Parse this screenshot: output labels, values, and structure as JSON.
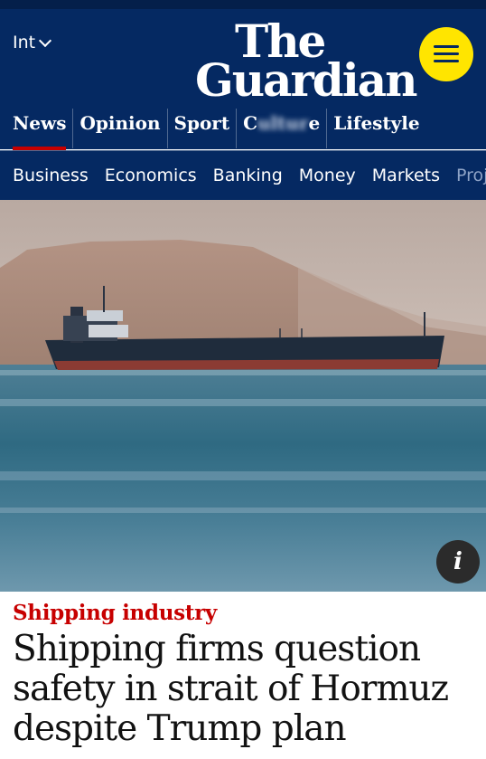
{
  "header": {
    "edition": "Int",
    "logo_line1": "The",
    "logo_line2": "Guardian"
  },
  "pillars": [
    {
      "label": "News",
      "active": true
    },
    {
      "label": "Opinion"
    },
    {
      "label": "Sport"
    },
    {
      "label_visible_start": "C",
      "label_visible_end": "e",
      "blurred": true
    },
    {
      "label": "Lifestyle"
    }
  ],
  "subnav": [
    "Business",
    "Economics",
    "Banking",
    "Money",
    "Markets",
    "Proj"
  ],
  "article": {
    "kicker": "Shipping industry",
    "headline": "Shipping firms question safety in strait of Hormuz despite Trump plan"
  },
  "icons": {
    "menu": "hamburger-icon",
    "info": "info-icon",
    "edition": "chevron-down-icon"
  },
  "colors": {
    "brand_navy": "#052962",
    "menu_yellow": "#ffe500",
    "news_red": "#c70000"
  }
}
